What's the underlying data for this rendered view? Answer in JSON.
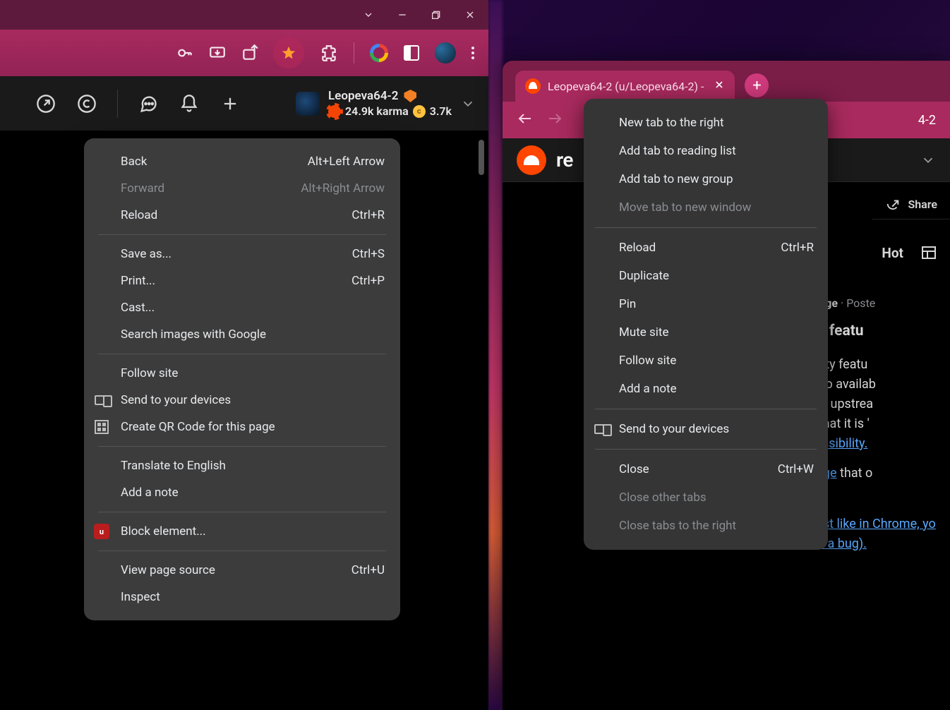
{
  "left": {
    "user": {
      "name": "Leopeva64-2",
      "karma": "24.9k karma",
      "coins": "3.7k"
    },
    "ctx": {
      "back": "Back",
      "back_sc": "Alt+Left Arrow",
      "forward": "Forward",
      "forward_sc": "Alt+Right Arrow",
      "reload": "Reload",
      "reload_sc": "Ctrl+R",
      "saveas": "Save as...",
      "saveas_sc": "Ctrl+S",
      "print": "Print...",
      "print_sc": "Ctrl+P",
      "cast": "Cast...",
      "searchimg": "Search images with Google",
      "follow": "Follow site",
      "send": "Send to your devices",
      "qr": "Create QR Code for this page",
      "translate": "Translate to English",
      "addnote": "Add a note",
      "block": "Block element...",
      "viewsrc": "View page source",
      "viewsrc_sc": "Ctrl+U",
      "inspect": "Inspect"
    }
  },
  "right": {
    "tab_title": "Leopeva64-2 (u/Leopeva64-2) -",
    "addr_trail": "4-2",
    "reddit_word": "re",
    "share": "Share",
    "hot": "Hot",
    "meta_sub": "tEdge",
    "meta_posted": "Poste",
    "title_frag": "on featu",
    "body1": "bility featu",
    "body2": "also availab",
    "body3": "om upstrea",
    "body4": "s that it is '",
    "link1": "cessibility.",
    "link2a": "page",
    "body5": " that o",
    "link3": "Just like in Chrome, yo",
    "link4": "it's a bug).",
    "ctx": {
      "newtab": "New tab to the right",
      "reading": "Add tab to reading list",
      "group": "Add tab to new group",
      "movewin": "Move tab to new window",
      "reload": "Reload",
      "reload_sc": "Ctrl+R",
      "dup": "Duplicate",
      "pin": "Pin",
      "mute": "Mute site",
      "follow": "Follow site",
      "addnote": "Add a note",
      "send": "Send to your devices",
      "close": "Close",
      "close_sc": "Ctrl+W",
      "closeother": "Close other tabs",
      "closeright": "Close tabs to the right"
    }
  }
}
